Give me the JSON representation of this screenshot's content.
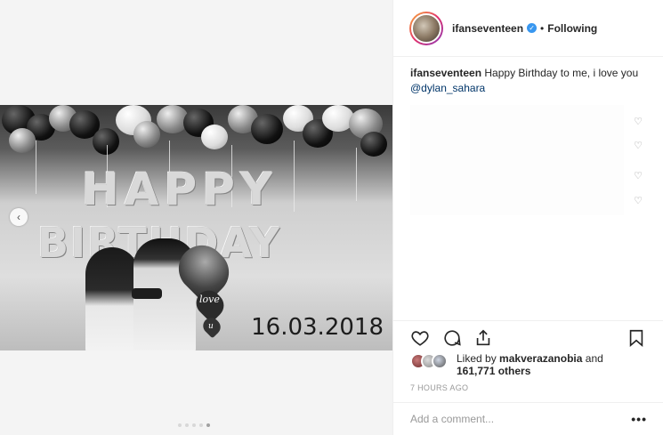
{
  "post": {
    "date_overlay": "16.03.2018",
    "carousel": {
      "count": 5,
      "active_index": 4
    },
    "photo_text": {
      "row1": "HAPPY",
      "row2": "BIRTHDAY",
      "heart_text": "love",
      "heart_small_text": "u"
    }
  },
  "header": {
    "username": "ifanseventeen",
    "separator": "•",
    "follow_status": "Following"
  },
  "caption": {
    "username": "ifanseventeen",
    "text": "Happy Birthday to me, i love you",
    "mention": "@dylan_sahara"
  },
  "comments": {
    "like_icon": "heart-outline-icon",
    "count_visible": 4
  },
  "likes": {
    "prefix": "Liked by",
    "user": "makverazanobia",
    "and": "and",
    "others": "161,771 others"
  },
  "timestamp": "7 HOURS AGO",
  "comment_box": {
    "placeholder": "Add a comment...",
    "more": "•••"
  },
  "colors": {
    "link": "#003569",
    "verified": "#3897f0",
    "muted": "#999999",
    "border": "#efefef"
  }
}
